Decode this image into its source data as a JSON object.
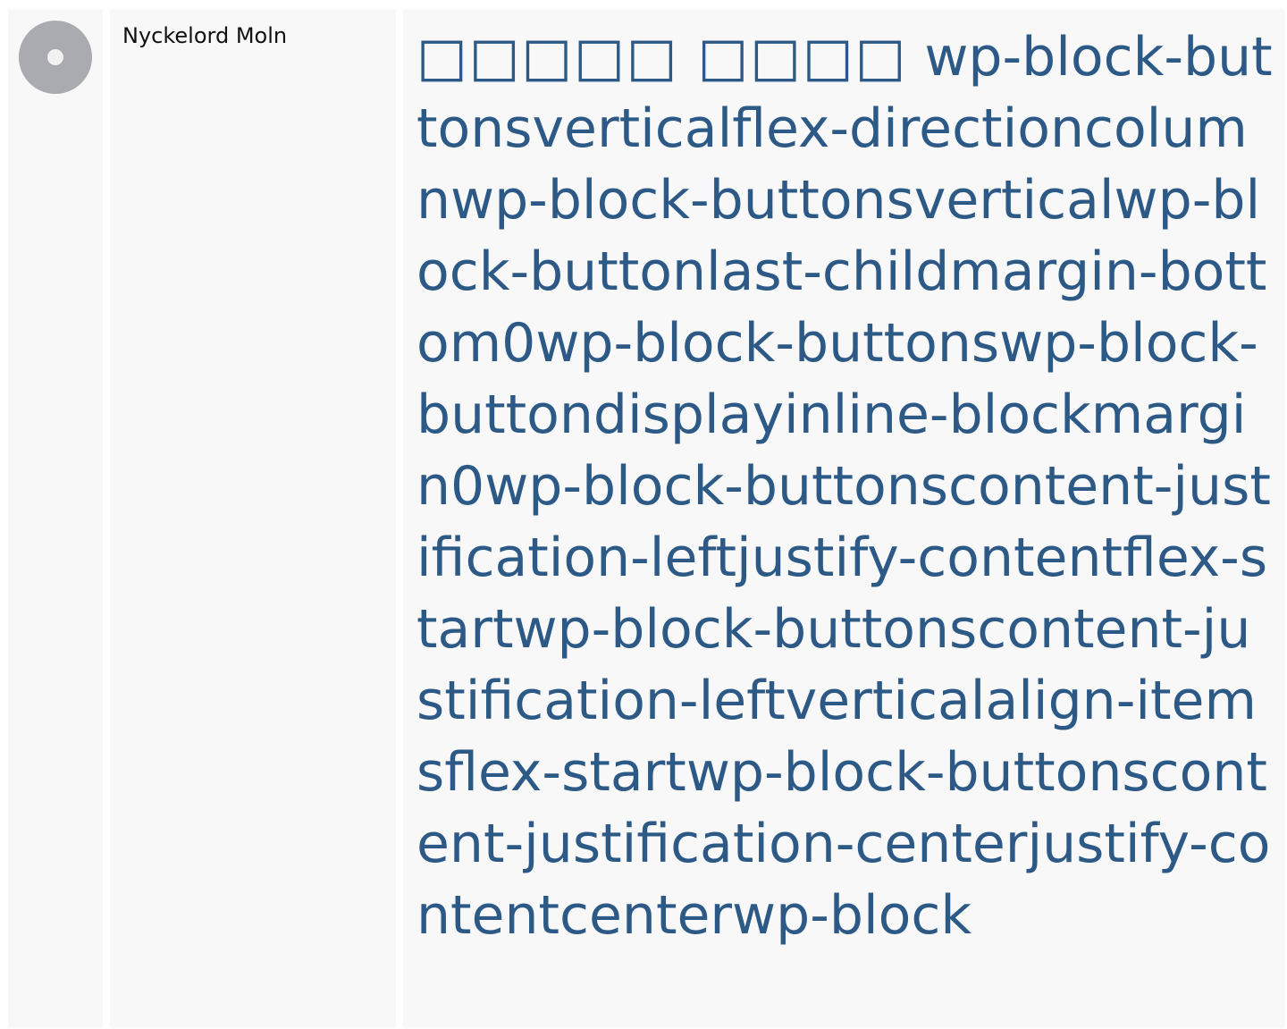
{
  "icon": {
    "name": "disc-icon",
    "color": "#a9abb0"
  },
  "section": {
    "title": "Nyckelord Moln"
  },
  "keywords": {
    "prefix": "□□□□□ □□□□",
    "text": "wp-block-buttonsverticalflex-directioncolumnwp-block-buttonsverticalwp-block-buttonlast-childmargin-bottom0wp-block-buttonswp-block-buttondisplayinline-blockmargin0wp-block-buttonscontent-justification-leftjustify-contentflex-startwp-block-buttonscontent-justification-leftverticalalign-itemsflex-startwp-block-buttonscontent-justification-centerjustify-contentcenterwp-block",
    "color": "#2c5985"
  }
}
